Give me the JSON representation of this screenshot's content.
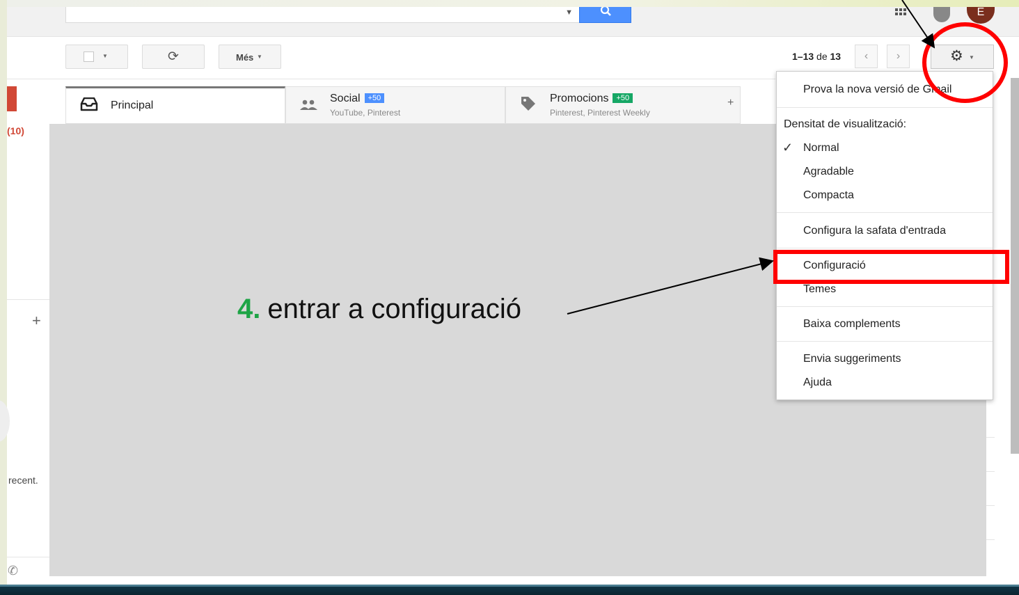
{
  "topbar": {
    "search_placeholder": "",
    "search_dropdown_icon": "caret-down-icon",
    "search_button_icon": "magnifier-icon",
    "apps_icon": "grid-icon",
    "notifications_icon": "bell-icon",
    "avatar_initial": "E"
  },
  "toolbar": {
    "more_label": "Més",
    "pager": {
      "range": "1–13",
      "of": "de",
      "total": "13"
    }
  },
  "tabs": [
    {
      "title": "Principal",
      "subtitle": "",
      "badge": ""
    },
    {
      "title": "Social",
      "subtitle": "YouTube, Pinterest",
      "badge": "+50"
    },
    {
      "title": "Promocions",
      "subtitle": "Pinterest, Pinterest Weekly",
      "badge": "+50"
    }
  ],
  "sidebar": {
    "inbox_count": "(10)",
    "recent_text": "recent."
  },
  "annotation": {
    "step_number": "4.",
    "text": "entrar a configuració"
  },
  "menu": {
    "try_new": "Prova la nova versió de Gmail",
    "density_header": "Densitat de visualització:",
    "density_normal": "Normal",
    "density_comfortable": "Agradable",
    "density_compact": "Compacta",
    "configure_inbox": "Configura la safata d'entrada",
    "settings": "Configuració",
    "themes": "Temes",
    "get_addons": "Baixa complements",
    "send_feedback": "Envia suggeriments",
    "help": "Ajuda"
  },
  "colors": {
    "highlight_red": "#ff0000",
    "step_green": "#1ea446",
    "google_blue": "#4d90fe"
  }
}
